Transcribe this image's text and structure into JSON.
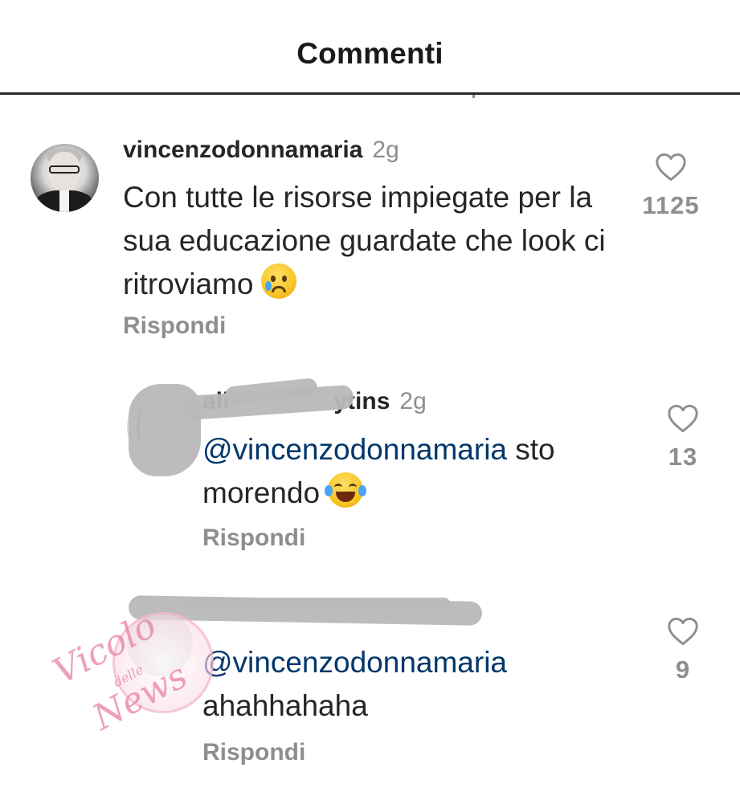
{
  "header": {
    "title": "Commenti"
  },
  "comments": [
    {
      "username": "vincenzodonnamaria",
      "time": "2g",
      "text": "Con tutte le risorse impiegate per la sua educazione guardate che look ci ritroviamo",
      "emoji": "crying-face-emoji",
      "reply_label": "Rispondi",
      "likes": "1125"
    },
    {
      "username_visible_start": "ali",
      "username_visible_end": "ytins",
      "time": "2g",
      "mention": "@vincenzodonnamaria",
      "text_line1_rest": " sto",
      "text_line2": "morendo",
      "emoji": "tears-of-joy-emoji",
      "reply_label": "Rispondi",
      "likes": "13"
    },
    {
      "mention": "@vincenzodonnamaria",
      "text_line2": "ahahhahaha",
      "reply_label": "Rispondi",
      "likes": "9"
    }
  ],
  "watermark": {
    "line1": "Vicolo",
    "line2": "delle",
    "line3": "News"
  },
  "colors": {
    "text": "#262626",
    "muted": "#8e8e8e",
    "mention": "#00376b",
    "redaction": "#b8b8b8"
  }
}
